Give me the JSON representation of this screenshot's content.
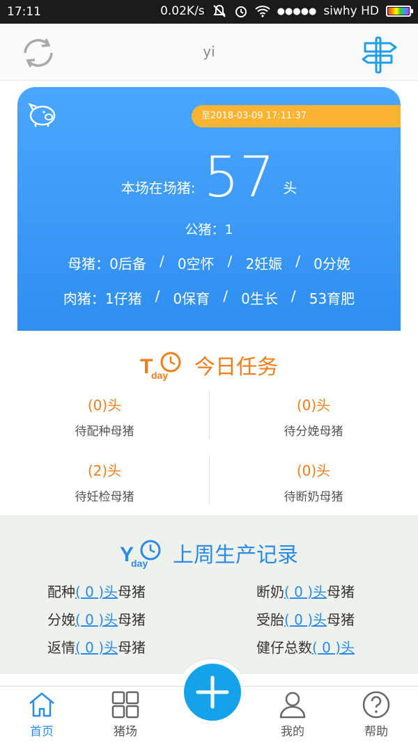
{
  "status_bar": {
    "time": "17:11",
    "speed": "0.02K/s",
    "carrier": "siwhy HD",
    "signal": "●●●●●"
  },
  "header": {
    "title": "yi"
  },
  "summary": {
    "date": "至2018-03-09 17:11:37",
    "total_label": "本场在场猪:",
    "total_count": "57",
    "total_unit": "头",
    "boar": "公猪：1",
    "sow_label": "母猪：",
    "sow": [
      "0后备",
      "0空怀",
      "2妊娠",
      "0分娩"
    ],
    "meat_label": "肉猪：",
    "meat": [
      "1仔猪",
      "0保育",
      "0生长",
      "53育肥"
    ],
    "separator": "/"
  },
  "today": {
    "title": "今日任务",
    "tasks": [
      {
        "count": "(0)头",
        "label": "待配种母猪"
      },
      {
        "count": "(0)头",
        "label": "待分娩母猪"
      },
      {
        "count": "(2)头",
        "label": "待妊检母猪"
      },
      {
        "count": "(0)头",
        "label": "待断奶母猪"
      }
    ]
  },
  "last_week": {
    "title": "上周生产记录",
    "records": [
      {
        "prefix": "配种",
        "link": "( 0 )头",
        "suffix": "母猪"
      },
      {
        "prefix": "断奶",
        "link": "( 0 )头",
        "suffix": "母猪"
      },
      {
        "prefix": "分娩",
        "link": "( 0 )头",
        "suffix": "母猪"
      },
      {
        "prefix": "受胎",
        "link": "( 0 )头",
        "suffix": "母猪"
      },
      {
        "prefix": "返情",
        "link": "( 0 )头",
        "suffix": "母猪"
      },
      {
        "prefix": "健仔总数",
        "link": "( 0 )头",
        "suffix": ""
      }
    ]
  },
  "nav": {
    "items": [
      {
        "label": "首页"
      },
      {
        "label": "猪场"
      },
      {
        "label": "我的"
      },
      {
        "label": "帮助"
      }
    ]
  },
  "colors": {
    "accent_blue": "#2a8be8",
    "accent_orange": "#ef7d1a",
    "badge_yellow": "#fbb432",
    "fab_blue": "#14a3ea"
  }
}
